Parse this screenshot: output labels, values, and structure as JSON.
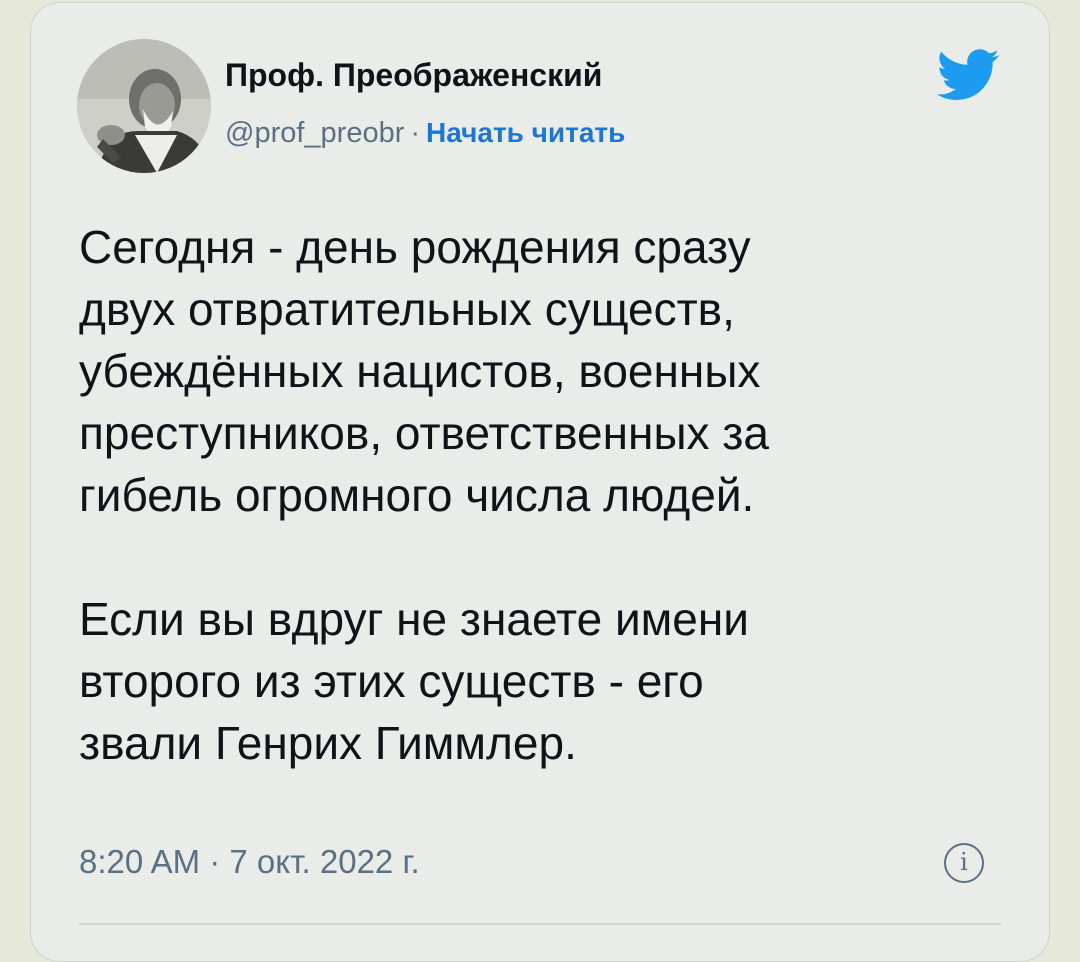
{
  "tweet": {
    "author_name": "Проф. Преображенский",
    "handle": "@prof_preobr",
    "separator": "·",
    "follow_label": "Начать читать",
    "text": "Сегодня - день рождения сразу\nдвух отвратительных существ,\nубеждённых нацистов, военных\nпреступников, ответственных за\nгибель огромного числа людей.\n\nЕсли вы вдруг не знаете имени\nвторого из этих существ - его\nзвали Генрих Гиммлер.",
    "timestamp": "8:20 AM · 7 окт. 2022 г.",
    "info_glyph": "i"
  },
  "icons": {
    "brand": "twitter-bird-icon",
    "info": "info-icon",
    "avatar": "profile-photo"
  },
  "colors": {
    "brand": "#1d9bf0",
    "link": "#1d76d2",
    "muted": "#5b7083",
    "text": "#0f1419"
  }
}
